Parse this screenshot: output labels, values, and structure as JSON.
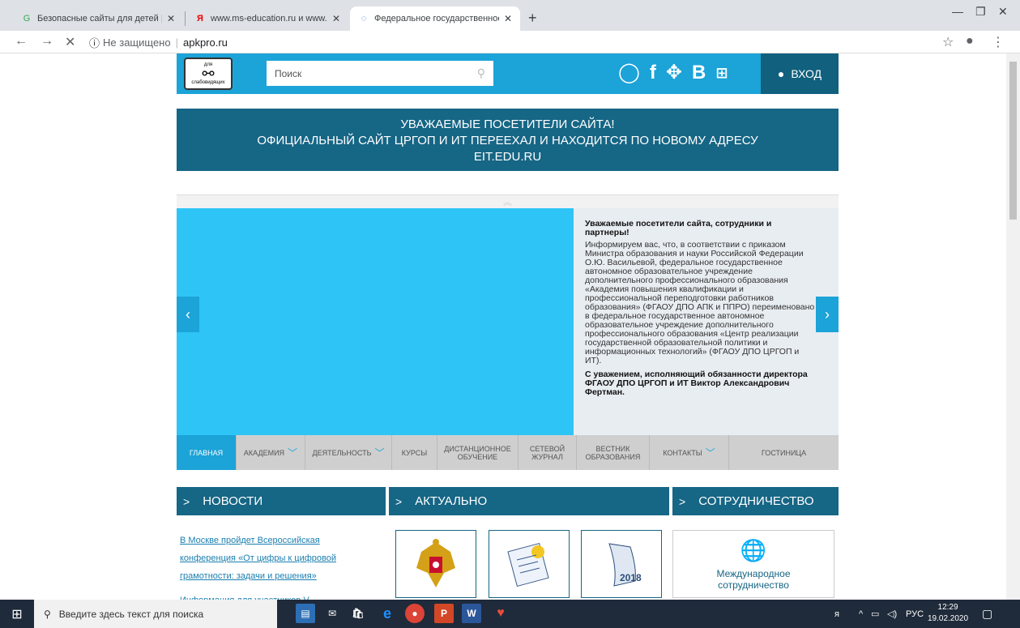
{
  "browser": {
    "tabs": [
      {
        "title": "Безопасные сайты для детей | Г",
        "favicon": "green-g-icon"
      },
      {
        "title": "www.ms-education.ru и www.apk",
        "favicon": "yandex-icon"
      },
      {
        "title": "Федеральное государственное",
        "favicon": "loading-spinner-icon"
      }
    ],
    "security_label": "Не защищено",
    "url": "apkpro.ru"
  },
  "header": {
    "logo_top": "для",
    "logo_bottom": "слабовидящих",
    "search_placeholder": "Поиск",
    "login_label": "ВХОД"
  },
  "banner": {
    "line1": "УВАЖАЕМЫЕ ПОСЕТИТЕЛИ САЙТА!",
    "line2": "ОФИЦИАЛЬНЫЙ САЙТ ЦРГОП И ИТ ПЕРЕЕХАЛ И НАХОДИТСЯ ПО НОВОМУ АДРЕСУ",
    "line3": "EIT.EDU.RU"
  },
  "slider": {
    "heading": "Уважаемые посетители сайта, сотрудники и партнеры!",
    "body": "Информируем вас, что, в соответствии с приказом Министра образования и науки Российской Федерации О.Ю. Васильевой, федеральное государственное автономное образовательное учреждение дополнительного профессионального образования «Академия повышения квалификации и профессиональной переподготовки работников образования» (ФГАОУ ДПО АПК и ППРО) переименовано в федеральное государственное автономное образовательное учреждение дополнительного профессионального образования «Центр реализации государственной образовательной политики и информационных технологий» (ФГАОУ ДПО ЦРГОП и ИТ).",
    "signature": "С уважением, исполняющий обязанности директора ФГАОУ ДПО ЦРГОП и ИТ Виктор Александрович Фертман."
  },
  "menu": {
    "items": [
      {
        "label": "ГЛАВНАЯ"
      },
      {
        "label": "АКАДЕМИЯ"
      },
      {
        "label": "ДЕЯТЕЛЬНОСТЬ"
      },
      {
        "label": "КУРСЫ"
      },
      {
        "label": "ДИСТАНЦИОННОЕ ОБУЧЕНИЕ"
      },
      {
        "label": "СЕТЕВОЙ ЖУРНАЛ"
      },
      {
        "label": "ВЕСТНИК ОБРАЗОВАНИЯ"
      },
      {
        "label": "КОНТАКТЫ"
      },
      {
        "label": "ГОСТИНИЦА"
      }
    ]
  },
  "sections": {
    "news": "НОВОСТИ",
    "actual": "АКТУАЛЬНО",
    "coop": "СОТРУДНИЧЕСТВО"
  },
  "news_items": [
    "В Москве пройдет Всероссийская",
    "конференция «От цифры к цифровой",
    "грамотности: задачи и решения»",
    "Информация для участников V"
  ],
  "tiles": {
    "year_badge": "2018",
    "coop_label": "Международное сотрудничество"
  },
  "taskbar": {
    "search_placeholder": "Введите здесь текст для поиска",
    "lang": "РУС",
    "time": "12:29",
    "date": "19.02.2020"
  },
  "colors": {
    "accent": "#1ca3d7",
    "dark": "#166685"
  }
}
